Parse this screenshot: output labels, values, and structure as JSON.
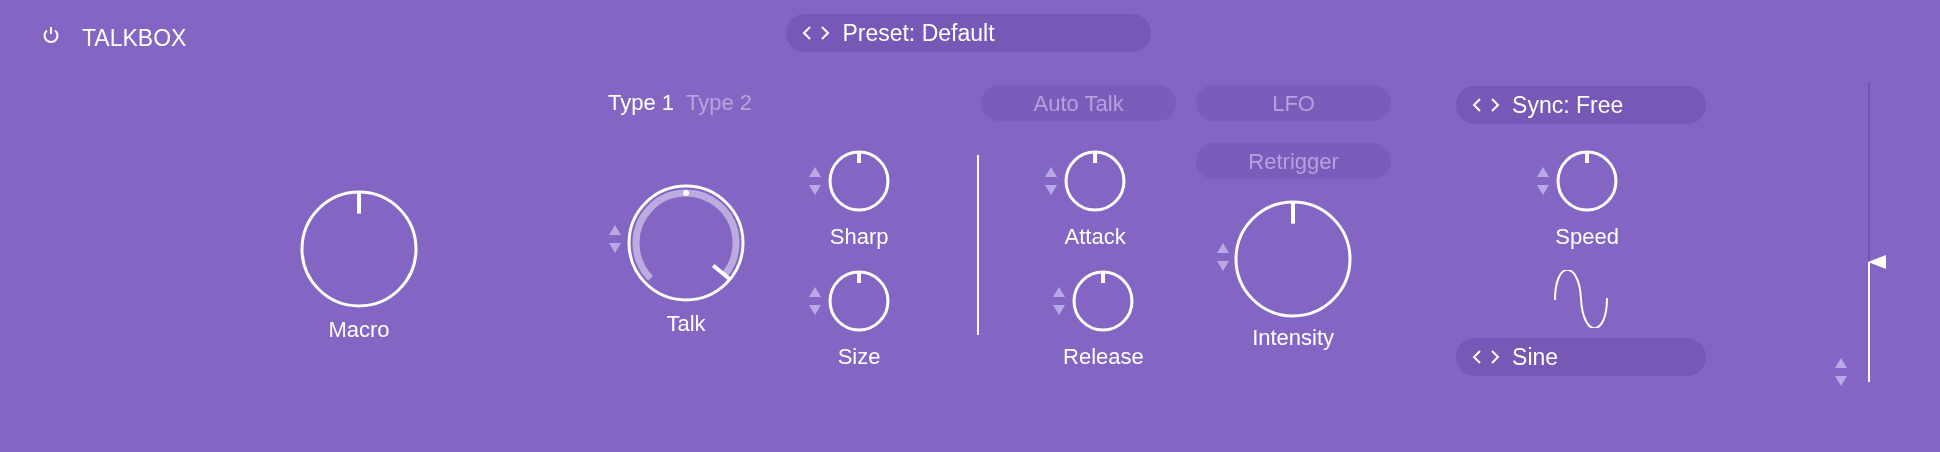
{
  "header": {
    "title": "TALKBOX",
    "preset": {
      "label": "Preset: Default"
    }
  },
  "macro": {
    "label": "Macro"
  },
  "type_tabs": [
    {
      "label": "Type 1",
      "selected": true
    },
    {
      "label": "Type 2",
      "selected": false
    }
  ],
  "talk": {
    "label": "Talk"
  },
  "sharp": {
    "label": "Sharp"
  },
  "size": {
    "label": "Size"
  },
  "auto_talk": {
    "label": "Auto Talk",
    "on": false
  },
  "attack": {
    "label": "Attack"
  },
  "release": {
    "label": "Release"
  },
  "lfo": {
    "label": "LFO",
    "on": false
  },
  "retrigger": {
    "label": "Retrigger",
    "on": false
  },
  "intensity": {
    "label": "Intensity"
  },
  "sync": {
    "label": "Sync: Free"
  },
  "speed": {
    "label": "Speed"
  },
  "waveform": {
    "label": "Sine"
  },
  "output_slider": {
    "level": 0.4
  }
}
